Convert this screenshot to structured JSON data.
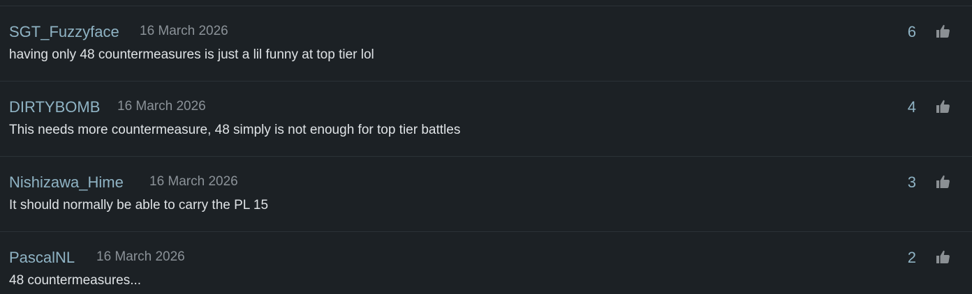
{
  "colors": {
    "background": "#1c2125",
    "author": "#8fb3c4",
    "date": "#8b9298",
    "text": "#dfe3e6",
    "icon": "#8b9094"
  },
  "comments": [
    {
      "author": "SGT_Fuzzyface",
      "date": "16 March 2026",
      "text": "having only 48 countermeasures is just a lil funny at top tier lol",
      "likes": "6",
      "like_icon": "thumbs-up-icon"
    },
    {
      "author": "DIRTYBOMB",
      "date": "16 March 2026",
      "text": "This needs more countermeasure, 48 simply is not enough for top tier battles",
      "likes": "4",
      "like_icon": "thumbs-up-icon"
    },
    {
      "author": "Nishizawa_Hime",
      "date": "16 March 2026",
      "text": "It should normally be able to carry the PL 15",
      "likes": "3",
      "like_icon": "thumbs-up-icon"
    },
    {
      "author": "PascalNL",
      "date": "16 March 2026",
      "text": "48 countermeasures...",
      "likes": "2",
      "like_icon": "thumbs-up-icon"
    }
  ]
}
